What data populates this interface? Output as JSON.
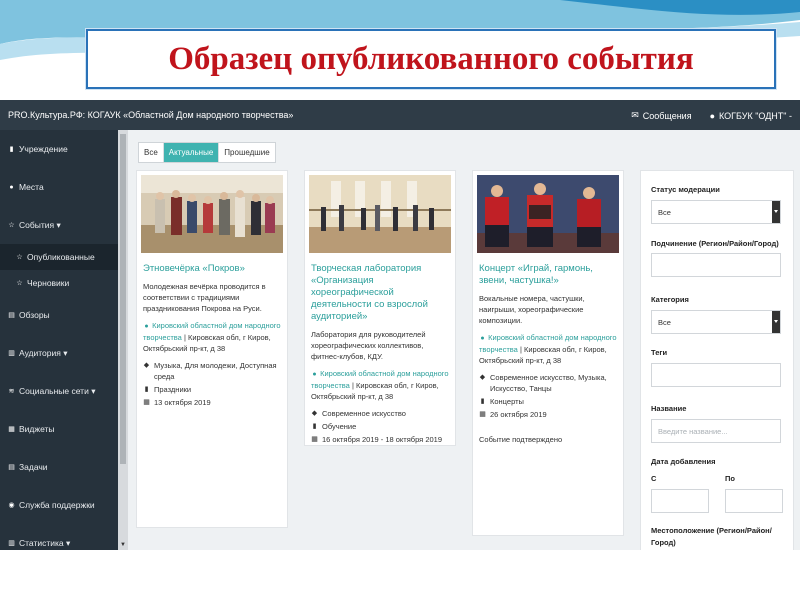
{
  "slide_title": "Образец опубликованного события",
  "topbar": {
    "site": "PRO.Культура.РФ: КОГАУК «Областной Дом народного творчества»",
    "messages": "Сообщения",
    "account": "КОГБУК \"ОДНТ\" -"
  },
  "sidebar": {
    "items": [
      {
        "icon": "building-icon",
        "label": "Учреждение"
      },
      {
        "icon": "map-pin-icon",
        "label": "Места"
      },
      {
        "icon": "star-icon",
        "label": "События ▾"
      },
      {
        "icon": "star-icon",
        "label": "Опубликованные"
      },
      {
        "icon": "star-icon",
        "label": "Черновики"
      },
      {
        "icon": "list-icon",
        "label": "Обзоры"
      },
      {
        "icon": "bar-chart-icon",
        "label": "Аудитория ▾"
      },
      {
        "icon": "vk-icon",
        "label": "Социальные сети ▾"
      },
      {
        "icon": "widget-icon",
        "label": "Виджеты"
      },
      {
        "icon": "tasks-icon",
        "label": "Задачи"
      },
      {
        "icon": "chat-icon",
        "label": "Служба поддержки"
      },
      {
        "icon": "bar-chart-icon",
        "label": "Статистика ▾"
      }
    ]
  },
  "filters": {
    "all": "Все",
    "current": "Актуальные",
    "past": "Прошедшие"
  },
  "cards": [
    {
      "title": "Этновечёрка «Покров»",
      "description": "Молодежная вечёрка проводится в соответствии с традициями праздникования Покрова на Руси.",
      "org": "Кировский областной дом народного творчества",
      "address": " | Кировская обл, г Киров, Октябрьский пр-кт, д 38",
      "tags": "Музыка, Для молодежи, Доступная среда",
      "category": "Праздники",
      "date": "13 октября 2019",
      "status": ""
    },
    {
      "title": "Творческая лаборатория «Организация хореографической деятельности со взрослой аудиторией»",
      "description": "Лаборатория для руководителей хореографических коллективов, фитнес-клубов, КДУ.",
      "org": "Кировский областной дом народного творчества",
      "address": " | Кировская обл, г Киров, Октябрьский пр-кт, д 38",
      "tags": "Современное искусство",
      "category": "Обучение",
      "date": "16 октября 2019 - 18 октября 2019",
      "status": ""
    },
    {
      "title": "Концерт «Играй, гармонь, звени, частушка!»",
      "description": "Вокальные номера, частушки, наигрыши, хореографические композиции.",
      "org": "Кировский областной дом народного творчества",
      "address": " | Кировская обл, г Киров, Октябрьский пр-кт, д 38",
      "tags": "Современное искусство, Музыка, Искусство, Танцы",
      "category": "Концерты",
      "date": "26 октября 2019",
      "status": "Событие подтверждено"
    }
  ],
  "right_panel": {
    "moderation_label": "Статус модерации",
    "moderation_value": "Все",
    "subordination_label": "Подчинение (Регион/Район/Город)",
    "category_label": "Категория",
    "category_value": "Все",
    "tags_label": "Теги",
    "name_label": "Название",
    "name_placeholder": "Введите название...",
    "date_label": "Дата добавления",
    "from_label": "С",
    "to_label": "По",
    "location_label": "Местоположение (Регион/Район/Город)"
  },
  "colors": {
    "accent": "#3fb3b0",
    "link": "#2b9f9b",
    "sidebar": "#26323c",
    "topbar": "#2f3c47",
    "title_red": "#c0141c"
  }
}
